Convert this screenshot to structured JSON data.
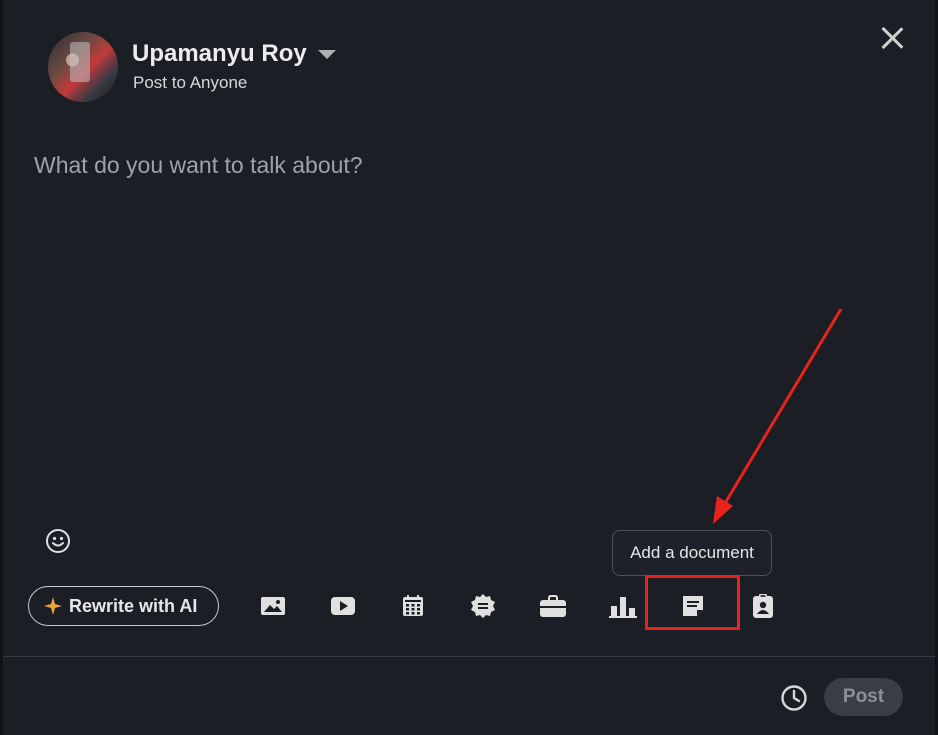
{
  "author": {
    "name": "Upamanyu Roy",
    "visibility": "Post to Anyone"
  },
  "editor": {
    "placeholder": "What do you want to talk about?"
  },
  "tooltip": {
    "text": "Add a document"
  },
  "toolbar": {
    "rewrite_label": "Rewrite with AI",
    "tools": [
      "image-icon",
      "video-icon",
      "calendar-event-icon",
      "celebrate-badge-icon",
      "briefcase-icon",
      "poll-chart-icon",
      "document-icon",
      "hiring-badge-icon"
    ]
  },
  "footer": {
    "post_label": "Post"
  },
  "colors": {
    "background": "#1b1e25",
    "annotation_red": "#e8231c",
    "ai_sparkle": "#e7a33e"
  }
}
